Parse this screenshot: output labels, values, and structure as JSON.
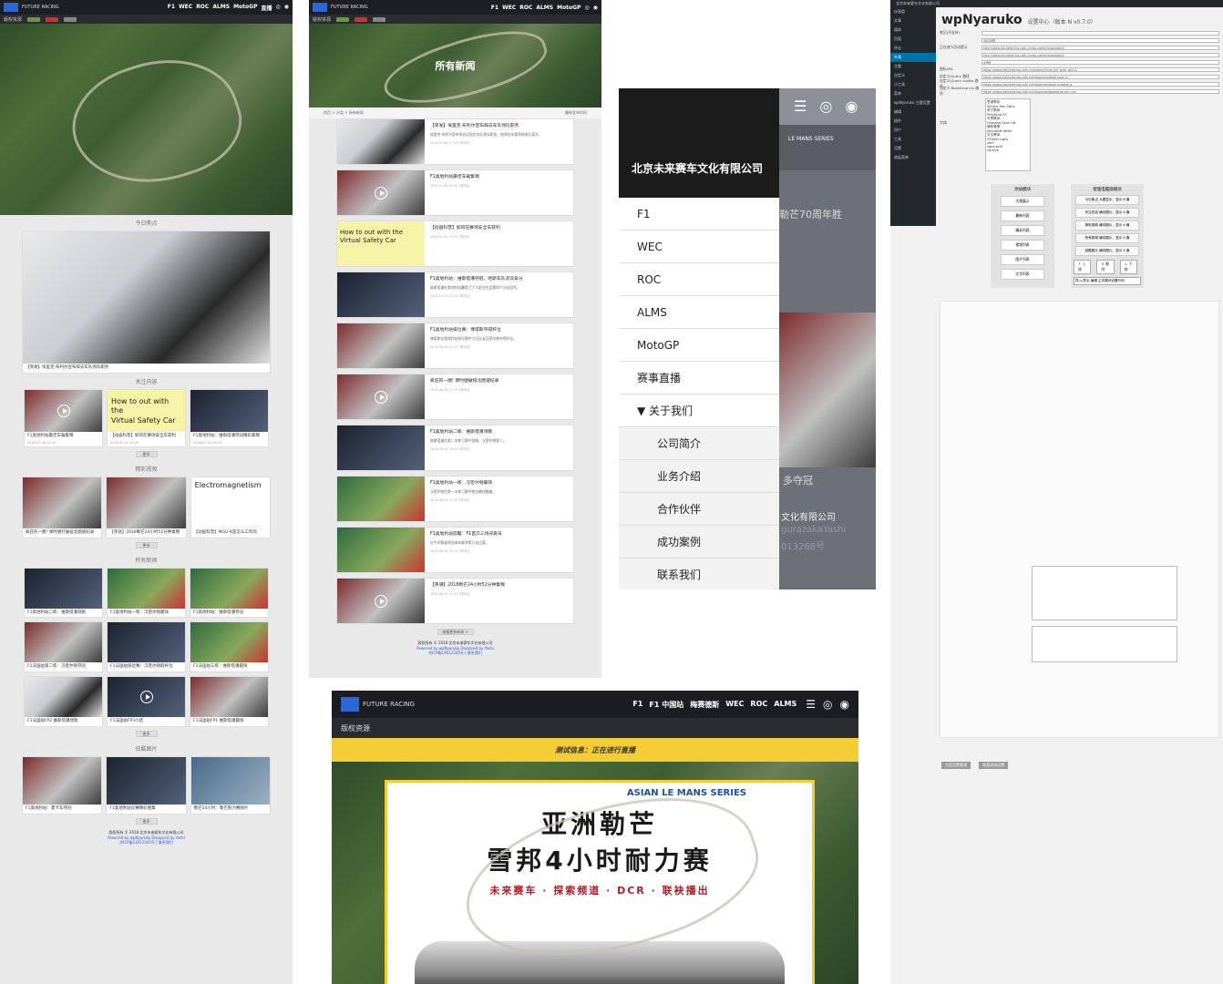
{
  "site": {
    "brand": "FUTURE RACING",
    "nav_short": [
      "F1",
      "WEC",
      "ROC",
      "ALMS",
      "MotoGP",
      "直播"
    ],
    "copyright_res": "版权资源"
  },
  "p1": {
    "section_today": "今日焦点",
    "headline": "【突发】埃里克·布利尔宣布辞去车队领队职务",
    "section_follow": "关注内容",
    "follow": [
      {
        "caption": "F1奥地利站最佳车载集锦",
        "meta": "2018.07.06  17:19"
      },
      {
        "caption": "【动画科普】如何在赛场安全车获利",
        "meta": "2018.07.02  10:20"
      },
      {
        "caption": "F1奥地利站：维斯塔潘夺冠精彩集锦",
        "meta": "2018.07.02  09:19"
      }
    ],
    "follow_overlay": "How to out with the\nVirtual Safety Car",
    "section_video": "精彩视频",
    "videos": [
      {
        "caption": "疯狂的一圈! 保时捷打破纽北圈速纪录"
      },
      {
        "caption": "【英语】2018勒芒24小时52分钟集锦"
      },
      {
        "caption": "【动画科普】MGU-K是怎么工作的"
      }
    ],
    "video_overlay": "Electromagnetism",
    "section_all": "所有新闻",
    "news": [
      "F1奥地利站二练：维斯塔潘领跑",
      "F1奥地利站一练：汉密尔顿最快",
      "F1奥地利站：维斯塔潘夺冠",
      "F1法国站第二练：汉密尔顿夺冠",
      "F1法国站排位赛：汉密尔顿取杆位",
      "F1法国站三练：维斯塔潘最快",
      "F1法国站FP2 维斯塔潘领跑",
      "F1法国站FP3小结",
      "F1法国站FP1 维斯塔潘最快"
    ],
    "section_photo": "炫酷图片",
    "photos": [
      "F1奥地利站：夏卡车夺冠",
      "F1奥地利站比赛精彩图集",
      "勒芒24小时：勒芒耐力赛图片"
    ],
    "more": "更多",
    "footer1": "版权所有 © 2018 北京未来赛车文化有限公司",
    "footer2": "Powered by wpNyaruko  Designed by Yashi",
    "footer3": "京ICP备14012345号 | 联系我们"
  },
  "p2": {
    "hero_title": "所有新闻",
    "breadcrumb": "首页 > 分类 > 所有新闻",
    "sort": "最新发布时间",
    "items": [
      {
        "title": "【突发】埃里克·布利尔宣布辞去车队领队职务",
        "text": "埃里克·布利尔宣布辞去迈凯伦车队领队职务，他将在本赛季结束后离开。",
        "meta": "2018.07.06  17:19  2条评论"
      },
      {
        "title": "F1奥地利站最佳车载集锦",
        "text": "",
        "meta": "2018.07.06  09:55  2条评论"
      },
      {
        "title": "【动画科普】如何在赛场安全车获利",
        "text": "",
        "meta": "2018.07.02  10:20  2条评论"
      },
      {
        "title": "F1奥地利站：维斯塔潘夺冠，哈斯车队双双拿分",
        "text": "维斯塔潘在奥地利站赢得了个人职业生涯第四个分站冠军。",
        "meta": "2018.07.02  10:19  2条评论"
      },
      {
        "title": "F1奥地利站排位赛：博塔斯夺得杆位",
        "text": "博塔斯在奥地利站排位赛中力压队友汉密尔顿夺得杆位。",
        "meta": "2018.06.30  22:27  2条评论"
      },
      {
        "title": "疯狂的一圈! 保时捷破纽北圈速纪录",
        "text": "",
        "meta": "2018.06.30  17:15  2条评论"
      },
      {
        "title": "F1奥地利站二练：维斯塔潘领跑",
        "text": "维斯塔潘在第二次练习赛中领跑，汉密尔顿第二。",
        "meta": "2018.06.29  23:22  2条评论"
      },
      {
        "title": "F1奥地利站一练：汉密尔顿最快",
        "text": "汉密尔顿在第一次练习赛中跑出最快圈速。",
        "meta": "2018.06.29  17:35  2条评论"
      },
      {
        "title": "F1奥地利站前瞻：F1首次三场背靠背",
        "text": "红牛环赛道将迎来本赛季第九站比赛。",
        "meta": "2018.06.28  09:15  2条评论"
      },
      {
        "title": "【英语】2018勒芒24小时52分钟集锦",
        "text": "",
        "meta": "2018.06.20  20:31  2条评论"
      }
    ],
    "overlay_vsc": "How to out with the\nVirtual Safety Car",
    "load_more": "查看更多新闻 >",
    "footer1": "版权所有 © 2018 北京未来赛车文化有限公司",
    "footer2": "Powered by wpNyaruko  Designed by Yashi",
    "footer3": "京ICP备14012345号 | 联系我们"
  },
  "p3": {
    "company": "北京未来赛车文化有限公司",
    "menu": [
      {
        "label": "F1",
        "sub": false
      },
      {
        "label": "WEC",
        "sub": false
      },
      {
        "label": "ROC",
        "sub": false
      },
      {
        "label": "ALMS",
        "sub": false
      },
      {
        "label": "MotoGP",
        "sub": false
      },
      {
        "label": "赛事直播",
        "sub": false
      },
      {
        "label": "▼ 关于我们",
        "sub": false
      },
      {
        "label": "公司简介",
        "sub": true
      },
      {
        "label": "业务介绍",
        "sub": true
      },
      {
        "label": "合作伙伴",
        "sub": true
      },
      {
        "label": "成功案例",
        "sub": true
      },
      {
        "label": "联系我们",
        "sub": true
      }
    ],
    "bg_text1": "LE MANS SERIES",
    "bg_text2": "勒芒70周年胜",
    "bg_text3": "多夺冠",
    "bg_text4": "文化有限公司",
    "bg_text5": "gurazakaYashi",
    "bg_text6": "013268号"
  },
  "p4": {
    "wp_title": "wpNyaruko",
    "subtitle": "设置中心（版本 N v0.7.0）",
    "topbar": "北京未来赛车文化有限公司",
    "sidebar": [
      "仪表盘",
      "文章",
      "媒体",
      "页面",
      "评论",
      "外观",
      "主题",
      "自定义",
      "小工具",
      "菜单",
      "wpNyaruko 主题设置",
      "编辑",
      "插件",
      "用户",
      "工具",
      "设置",
      "收起菜单"
    ],
    "fields": [
      {
        "label": "笔记(不支持)",
        "value": ""
      },
      {
        "label": "",
        "value": "活动标题"
      },
      {
        "label": "正在进行活动提示",
        "value": "http://www.futureracing.com.cn/wp-content/uploads/2"
      },
      {
        "label": "",
        "value": "http://www.futureracing.com.cn/wp-content/uploads/2"
      },
      {
        "label": "",
        "value": "#fffff"
      },
      {
        "label": "图标URL",
        "value": "https://www.futureracing.com.cn/logo/w2/icon-full_blue_w01.b"
      },
      {
        "label": "自定义jQuery 路径",
        "value": "https://www.futureracing.com.cn/resources/jquery.min.js"
      },
      {
        "label": "自定义jQuery cookie 路径",
        "value": "https://www.futureracing.com.cn/resources/jquery.cookie.js"
      },
      {
        "label": "自定义 Bootstrap css 路径",
        "value": "https://www.futureracing.com.cn/resources/bootstrap.min.css"
      }
    ],
    "fonts_label": "字体",
    "fonts_list": "思源黑体\nSource Han Sans\n苹方黑体\nPingFang SC\n冬青黑体\nHiragino Sans GB\n微软雅黑\nMicrosoft YaHei\n华文黑体\nSTHeiti Light\nserif\nsans-serif\ncursive",
    "module_add": "添加模块",
    "module_manage": "管理电脑版模块",
    "modules_left": [
      "大图展示",
      "最新内容",
      "精彩内容",
      "视频列表",
      "图片列表",
      "文字列表"
    ],
    "modules_right": [
      "今日焦点 大图显示，显示 8 篇",
      "关注内容 横向图片，显示 4 篇",
      "精彩视频 横向图片，显示 4 篇",
      "所有新闻 横向图片，显示 9 篇",
      "炫酷图片 横向图片，显示 4 篇"
    ],
    "btn_up": "↑ 上移",
    "btn_del": "× 删除",
    "btn_down": "↓ 下移",
    "btn_import": "导入/导出 编辑 主页模块设置代码",
    "save": "应用设置更改",
    "reset": "恢复初始设置"
  },
  "p5": {
    "brand": "FUTURE RACING",
    "nav": [
      "F1",
      "F1 中国站",
      "梅赛德斯",
      "WEC",
      "ROC",
      "ALMS"
    ],
    "copyright_res": "版权资源",
    "live_text": "测试信息：正在进行直播",
    "poster_line1": "亚洲勒芒",
    "poster_line2": "雪邦4小时耐力赛",
    "poster_lm": "ASIAN LE MANS SERIES",
    "poster_sponsors": "未来赛车 · 探索频道 · DCR · 联袂播出"
  }
}
